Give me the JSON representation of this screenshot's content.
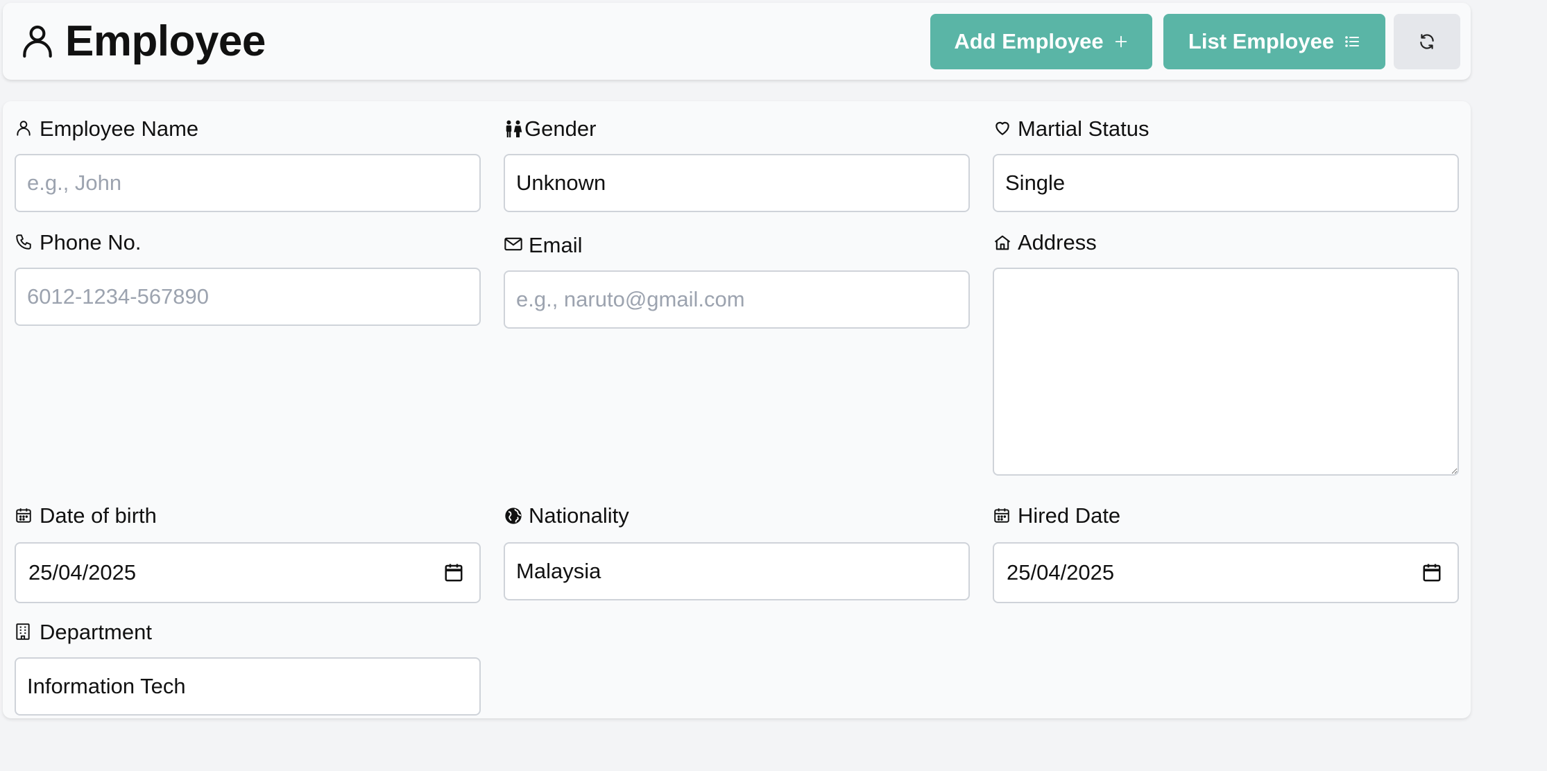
{
  "header": {
    "title": "Employee",
    "add_label": "Add Employee",
    "list_label": "List Employee"
  },
  "form": {
    "employee_name": {
      "label": "Employee Name",
      "value": "",
      "placeholder": "e.g., John"
    },
    "gender": {
      "label": "Gender",
      "value": "Unknown"
    },
    "marital_status": {
      "label": "Martial Status",
      "value": "Single"
    },
    "phone": {
      "label": "Phone No.",
      "value": "",
      "placeholder": "6012-1234-567890"
    },
    "email": {
      "label": "Email",
      "value": "",
      "placeholder": "e.g., naruto@gmail.com"
    },
    "address": {
      "label": "Address",
      "value": ""
    },
    "dob": {
      "label": "Date of birth",
      "value": "25/04/2025"
    },
    "nationality": {
      "label": "Nationality",
      "value": "Malaysia"
    },
    "hired_date": {
      "label": "Hired Date",
      "value": "25/04/2025"
    },
    "department": {
      "label": "Department",
      "value": "Information Tech"
    }
  },
  "icons": {
    "title": "user-icon",
    "add": "plus-icon",
    "list": "list-icon",
    "refresh": "refresh-icon",
    "gender": "gender-icon",
    "marital": "heart-icon",
    "phone": "phone-icon",
    "email": "mail-icon",
    "address": "home-icon",
    "dob": "calendar-icon",
    "nationality": "globe-icon",
    "hired": "calendar-icon",
    "department": "building-icon"
  },
  "colors": {
    "accent": "#5ab5a6",
    "background": "#f3f4f6",
    "panel": "#f9fafb"
  }
}
